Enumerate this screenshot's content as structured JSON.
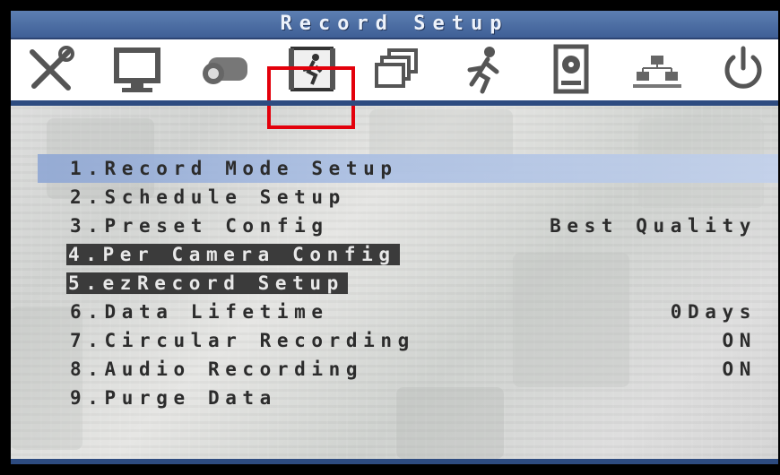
{
  "window": {
    "title": "Record Setup"
  },
  "toolbar": {
    "icons": [
      {
        "name": "tools-icon",
        "selected": false
      },
      {
        "name": "monitor-icon",
        "selected": false
      },
      {
        "name": "camera-icon",
        "selected": false
      },
      {
        "name": "record-icon",
        "selected": true
      },
      {
        "name": "windows-icon",
        "selected": false
      },
      {
        "name": "motion-icon",
        "selected": false
      },
      {
        "name": "disk-icon",
        "selected": false
      },
      {
        "name": "network-icon",
        "selected": false
      },
      {
        "name": "power-icon",
        "selected": false
      }
    ],
    "selected_color": "#e3000b"
  },
  "menu": {
    "items": [
      {
        "label": "1.Record Mode Setup",
        "value": ""
      },
      {
        "label": "2.Schedule Setup",
        "value": ""
      },
      {
        "label": "3.Preset Config",
        "value": "Best Quality"
      },
      {
        "label": "4.Per Camera Config",
        "value": ""
      },
      {
        "label": "5.ezRecord Setup",
        "value": ""
      },
      {
        "label": "6.Data Lifetime",
        "value": "0Days"
      },
      {
        "label": "7.Circular Recording",
        "value": "ON"
      },
      {
        "label": "8.Audio Recording",
        "value": "ON"
      },
      {
        "label": "9.Purge Data",
        "value": ""
      }
    ],
    "highlighted_item": "1.Record Mode Setup",
    "highlight_color": "#a8bde2"
  }
}
